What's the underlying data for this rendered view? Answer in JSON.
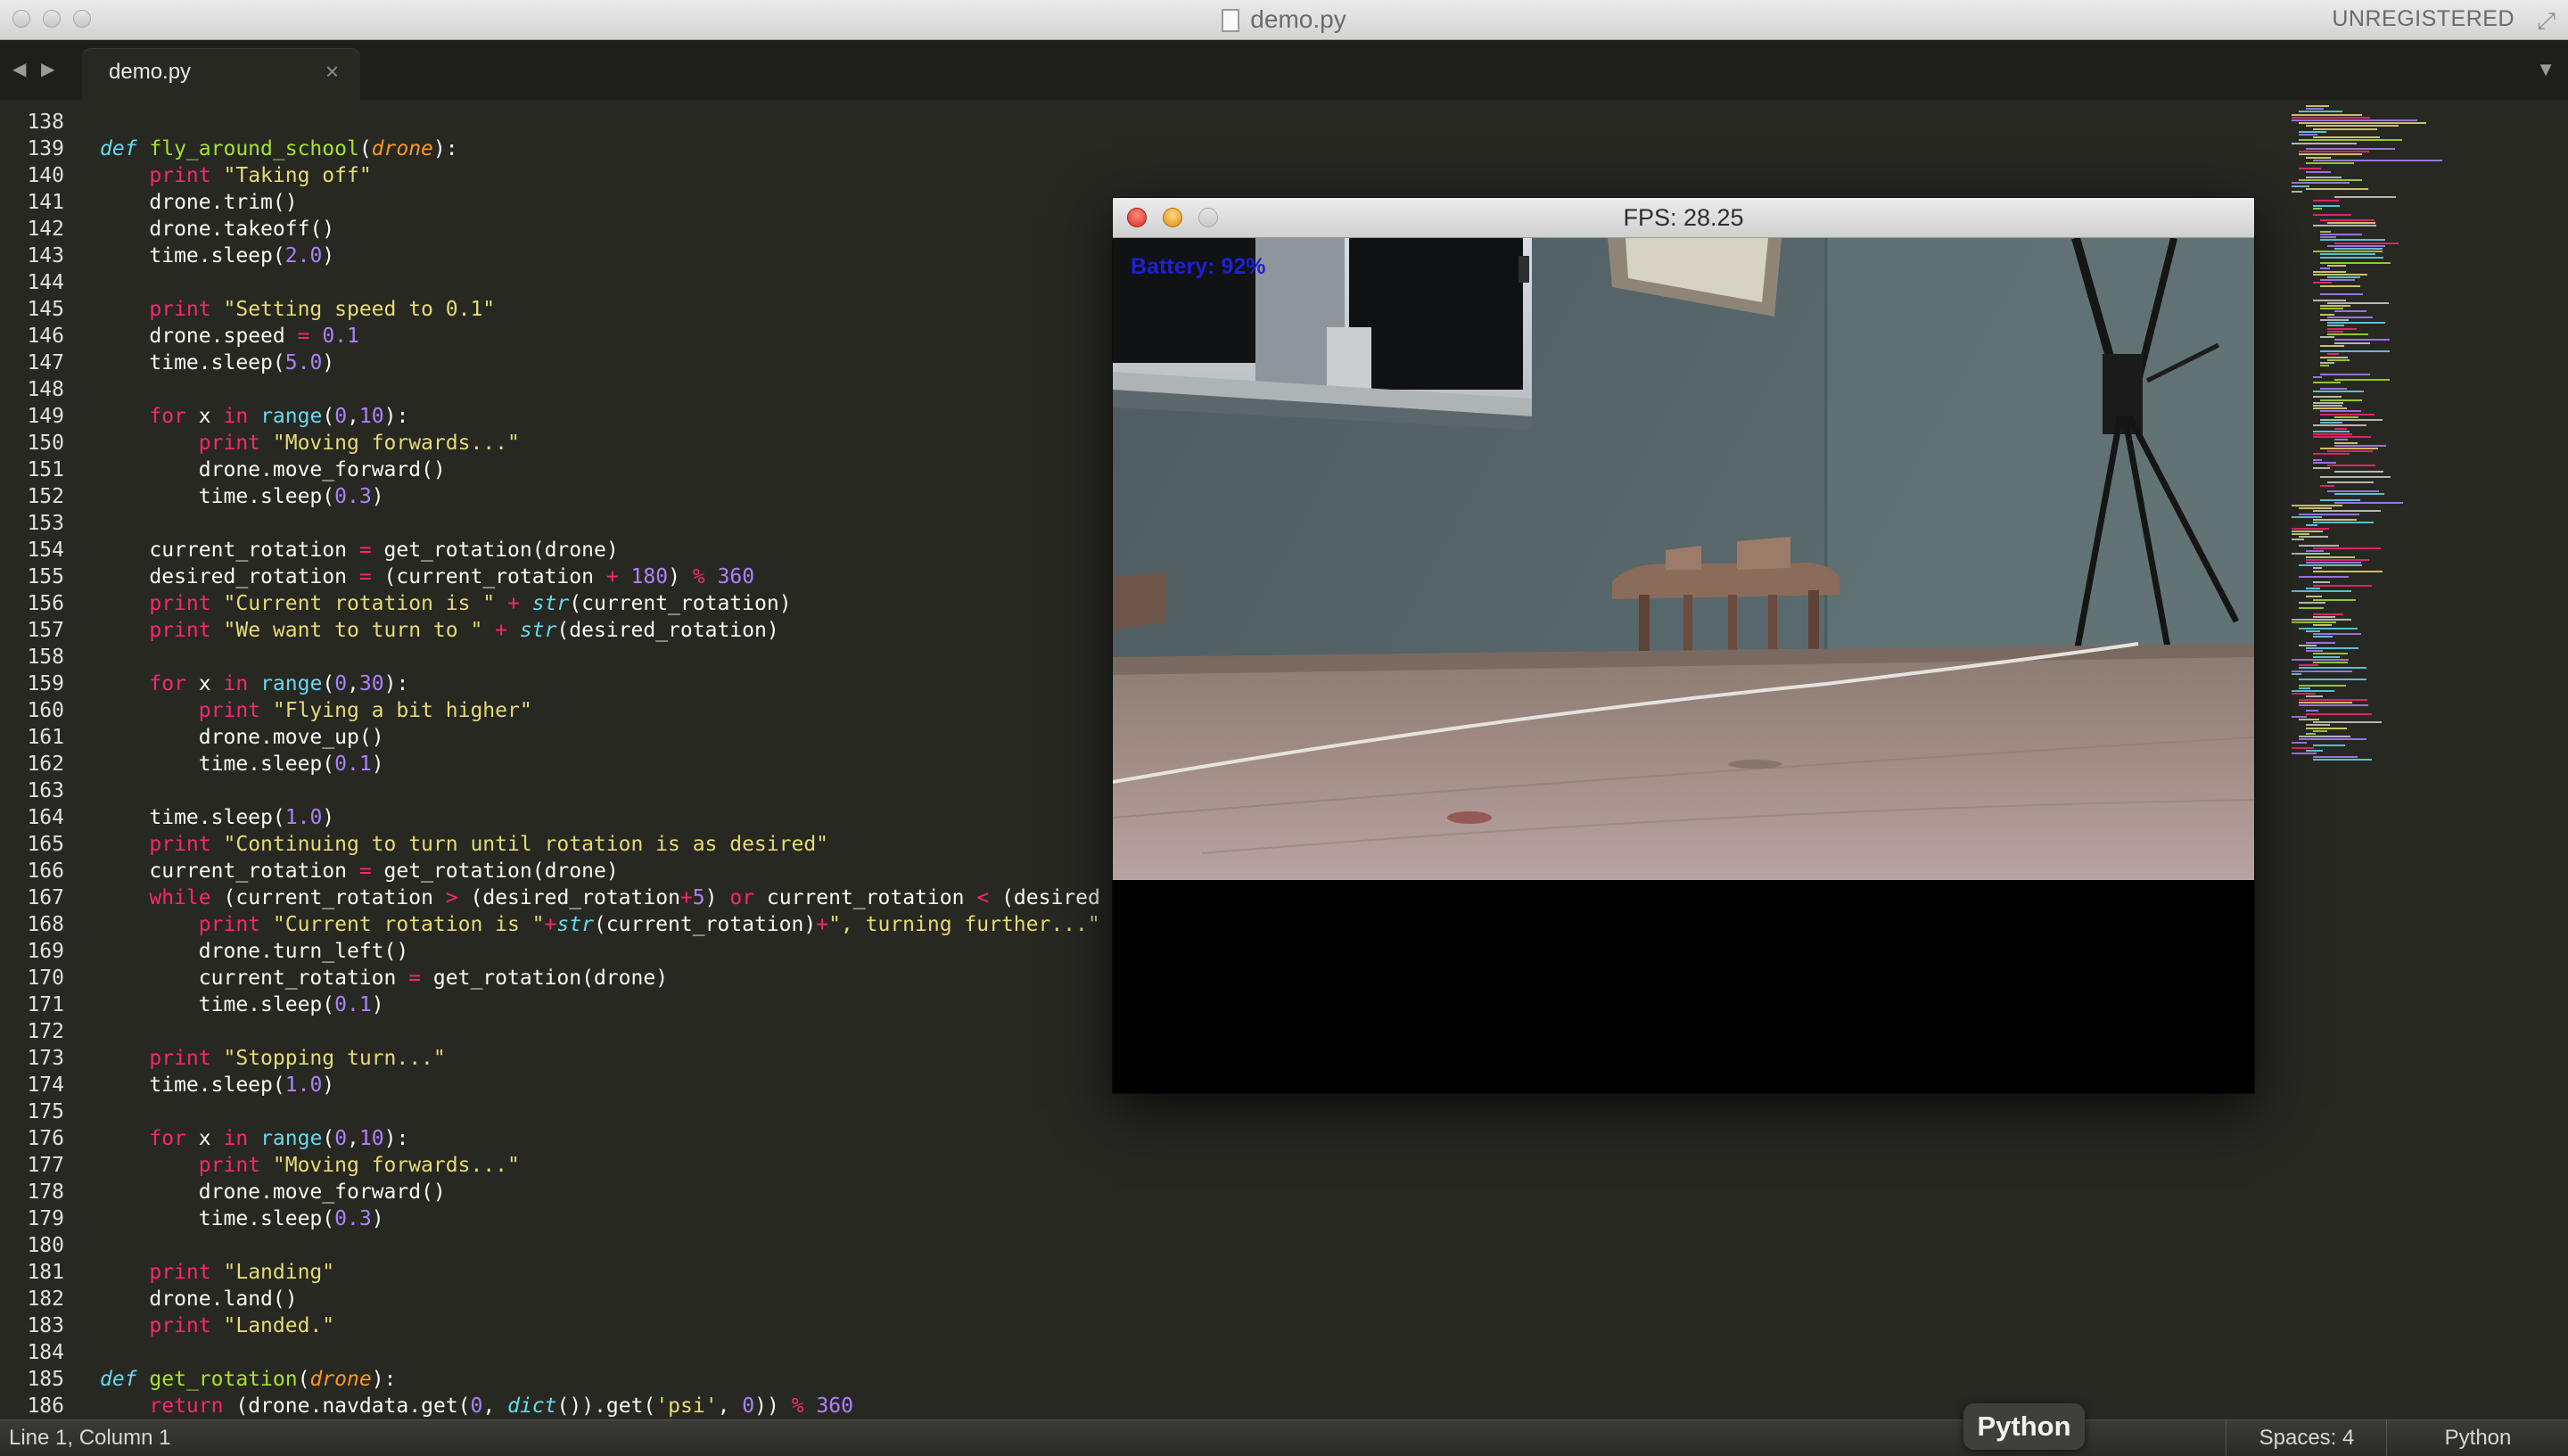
{
  "window": {
    "title": "demo.py",
    "registration": "UNREGISTERED"
  },
  "tabbar": {
    "active_tab": "demo.py",
    "close_glyph": "×",
    "back_glyph": "◀",
    "forward_glyph": "▶",
    "menu_glyph": "▼"
  },
  "editor": {
    "language": "python",
    "first_line_number": 138,
    "lines": [
      "",
      "def fly_around_school(drone):",
      "    print \"Taking off\"",
      "    drone.trim()",
      "    drone.takeoff()",
      "    time.sleep(2.0)",
      "",
      "    print \"Setting speed to 0.1\"",
      "    drone.speed = 0.1",
      "    time.sleep(5.0)",
      "",
      "    for x in range(0,10):",
      "        print \"Moving forwards...\"",
      "        drone.move_forward()",
      "        time.sleep(0.3)",
      "",
      "    current_rotation = get_rotation(drone)",
      "    desired_rotation = (current_rotation + 180) % 360",
      "    print \"Current rotation is \" + str(current_rotation)",
      "    print \"We want to turn to \" + str(desired_rotation)",
      "",
      "    for x in range(0,30):",
      "        print \"Flying a bit higher\"",
      "        drone.move_up()",
      "        time.sleep(0.1)",
      "",
      "    time.sleep(1.0)",
      "    print \"Continuing to turn until rotation is as desired\"",
      "    current_rotation = get_rotation(drone)",
      "    while (current_rotation > (desired_rotation+5) or current_rotation < (desired",
      "        print \"Current rotation is \"+str(current_rotation)+\", turning further...\"",
      "        drone.turn_left()",
      "        current_rotation = get_rotation(drone)",
      "        time.sleep(0.1)",
      "",
      "    print \"Stopping turn...\"",
      "    time.sleep(1.0)",
      "",
      "    for x in range(0,10):",
      "        print \"Moving forwards...\"",
      "        drone.move_forward()",
      "        time.sleep(0.3)",
      "",
      "    print \"Landing\"",
      "    drone.land()",
      "    print \"Landed.\"",
      "",
      "def get_rotation(drone):",
      "    return (drone.navdata.get(0, dict()).get('psi', 0)) % 360"
    ]
  },
  "video_window": {
    "title": "FPS: 28.25",
    "battery_label": "Battery: 92%"
  },
  "statusbar": {
    "cursor_position": "Line 1, Column 1",
    "indentation": "Spaces: 4",
    "syntax": "Python",
    "syntax_popup": "Python"
  },
  "theme": {
    "background": "#272822",
    "keyword": "#f92672",
    "function": "#a6e22e",
    "string": "#e6db74",
    "number": "#ae81ff",
    "builtin": "#66d9ef",
    "parameter": "#fd971f"
  },
  "icons": [
    "file-icon",
    "nav-back-icon",
    "nav-forward-icon",
    "close-icon",
    "tab-menu-icon",
    "fullscreen-icon"
  ]
}
